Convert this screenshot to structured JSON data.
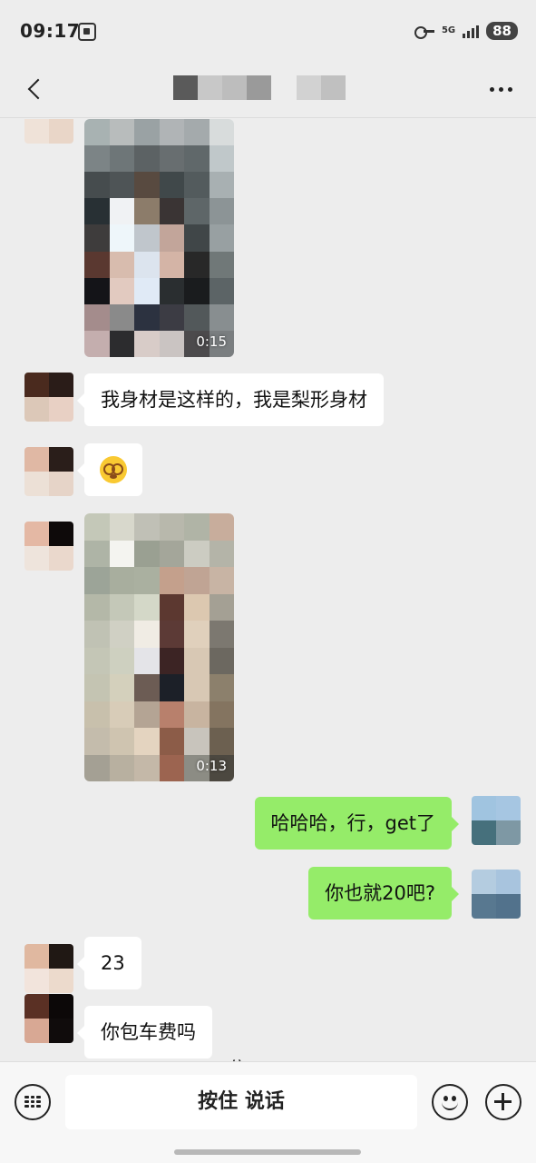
{
  "status_bar": {
    "time": "09:17",
    "network": "5G",
    "battery": "88"
  },
  "header": {
    "title_obscured": true
  },
  "messages": [
    {
      "sender": "contact",
      "type": "video",
      "duration": "0:15"
    },
    {
      "sender": "contact",
      "type": "text",
      "text": "我身材是这样的，我是梨形身材"
    },
    {
      "sender": "contact",
      "type": "emoji",
      "emoji": "dizzy-face"
    },
    {
      "sender": "contact",
      "type": "video",
      "duration": "0:13"
    },
    {
      "sender": "me",
      "type": "text",
      "text": "哈哈哈，行，get了"
    },
    {
      "sender": "me",
      "type": "text",
      "text": "你也就20吧?"
    },
    {
      "sender": "contact",
      "type": "text",
      "text": "23"
    },
    {
      "sender": "contact",
      "type": "text",
      "text": "你包车费吗"
    }
  ],
  "input_bar": {
    "hold_hint": "住",
    "hold_to_talk": "按住 说话",
    "left_icon": "keyboard-icon",
    "right_icons": [
      "emoji-icon",
      "plus-icon"
    ]
  },
  "colors": {
    "background": "#ededed",
    "my_bubble": "#95ec69",
    "their_bubble": "#ffffff"
  }
}
